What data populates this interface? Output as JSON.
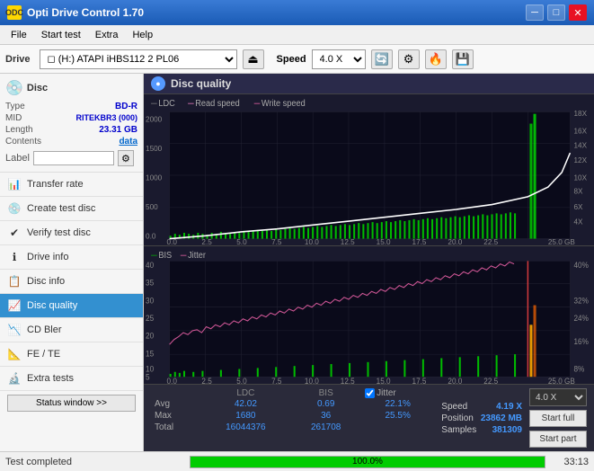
{
  "app": {
    "title": "Opti Drive Control 1.70",
    "icon": "ODC"
  },
  "titlebar": {
    "minimize_label": "─",
    "maximize_label": "□",
    "close_label": "✕"
  },
  "menubar": {
    "items": [
      "File",
      "Start test",
      "Extra",
      "Help"
    ]
  },
  "toolbar": {
    "drive_label": "Drive",
    "drive_value": "(H:)  ATAPI iHBS112  2 PL06",
    "speed_label": "Speed",
    "speed_value": "4.0 X"
  },
  "disc": {
    "header": "Disc",
    "type_label": "Type",
    "type_value": "BD-R",
    "mid_label": "MID",
    "mid_value": "RITEKBR3 (000)",
    "length_label": "Length",
    "length_value": "23.31 GB",
    "contents_label": "Contents",
    "contents_value": "data",
    "label_label": "Label",
    "label_value": ""
  },
  "nav": {
    "items": [
      {
        "id": "transfer-rate",
        "label": "Transfer rate",
        "icon": "📊"
      },
      {
        "id": "create-test-disc",
        "label": "Create test disc",
        "icon": "💿"
      },
      {
        "id": "verify-test-disc",
        "label": "Verify test disc",
        "icon": "✔"
      },
      {
        "id": "drive-info",
        "label": "Drive info",
        "icon": "ℹ"
      },
      {
        "id": "disc-info",
        "label": "Disc info",
        "icon": "📋"
      },
      {
        "id": "disc-quality",
        "label": "Disc quality",
        "icon": "📈",
        "active": true
      },
      {
        "id": "cd-bler",
        "label": "CD Bler",
        "icon": "📉"
      },
      {
        "id": "fe-te",
        "label": "FE / TE",
        "icon": "📐"
      },
      {
        "id": "extra-tests",
        "label": "Extra tests",
        "icon": "🔬"
      }
    ]
  },
  "status_window_btn": "Status window >>",
  "disc_quality": {
    "title": "Disc quality",
    "legend": {
      "ldc": "LDC",
      "read_speed": "Read speed",
      "write_speed": "Write speed",
      "bis": "BIS",
      "jitter": "Jitter"
    },
    "chart1": {
      "y_max": 2000,
      "y_labels": [
        "2000",
        "1500",
        "1000",
        "500",
        "0.0"
      ],
      "y_right_labels": [
        "18x",
        "16x",
        "14x",
        "12x",
        "10x",
        "8x",
        "6x",
        "4x"
      ],
      "x_labels": [
        "0.0",
        "2.5",
        "5.0",
        "7.5",
        "10.0",
        "12.5",
        "15.0",
        "17.5",
        "20.0",
        "22.5",
        "25.0 GB"
      ]
    },
    "chart2": {
      "y_max": 40,
      "y_labels": [
        "40",
        "35",
        "30",
        "25",
        "20",
        "15",
        "10",
        "5"
      ],
      "y_right_labels": [
        "40%",
        "32%",
        "24%",
        "16%",
        "8%"
      ],
      "x_labels": [
        "0.0",
        "2.5",
        "5.0",
        "7.5",
        "10.0",
        "12.5",
        "15.0",
        "17.5",
        "20.0",
        "22.5",
        "25.0 GB"
      ]
    }
  },
  "stats": {
    "headers": [
      "LDC",
      "BIS"
    ],
    "jitter_label": "Jitter",
    "jitter_checked": true,
    "rows": [
      {
        "label": "Avg",
        "ldc": "42.02",
        "bis": "0.69",
        "jitter": "22.1%"
      },
      {
        "label": "Max",
        "ldc": "1680",
        "bis": "36",
        "jitter": "25.5%"
      },
      {
        "label": "Total",
        "ldc": "16044376",
        "bis": "261708",
        "jitter": ""
      }
    ],
    "speed_label": "Speed",
    "speed_value": "4.19 X",
    "position_label": "Position",
    "position_value": "23862 MB",
    "samples_label": "Samples",
    "samples_value": "381309",
    "speed_select": "4.0 X",
    "start_full_label": "Start full",
    "start_part_label": "Start part"
  },
  "statusbar": {
    "status_text": "Test completed",
    "progress_percent": "100.0%",
    "time": "33:13"
  },
  "colors": {
    "ldc": "#00cc00",
    "read_speed": "#ffffff",
    "write_speed": "#ff69b4",
    "bis": "#00cc00",
    "jitter": "#ff69b4",
    "accent": "#3390d0",
    "chart_bg": "#1a1a2e",
    "grid": "#333355"
  }
}
